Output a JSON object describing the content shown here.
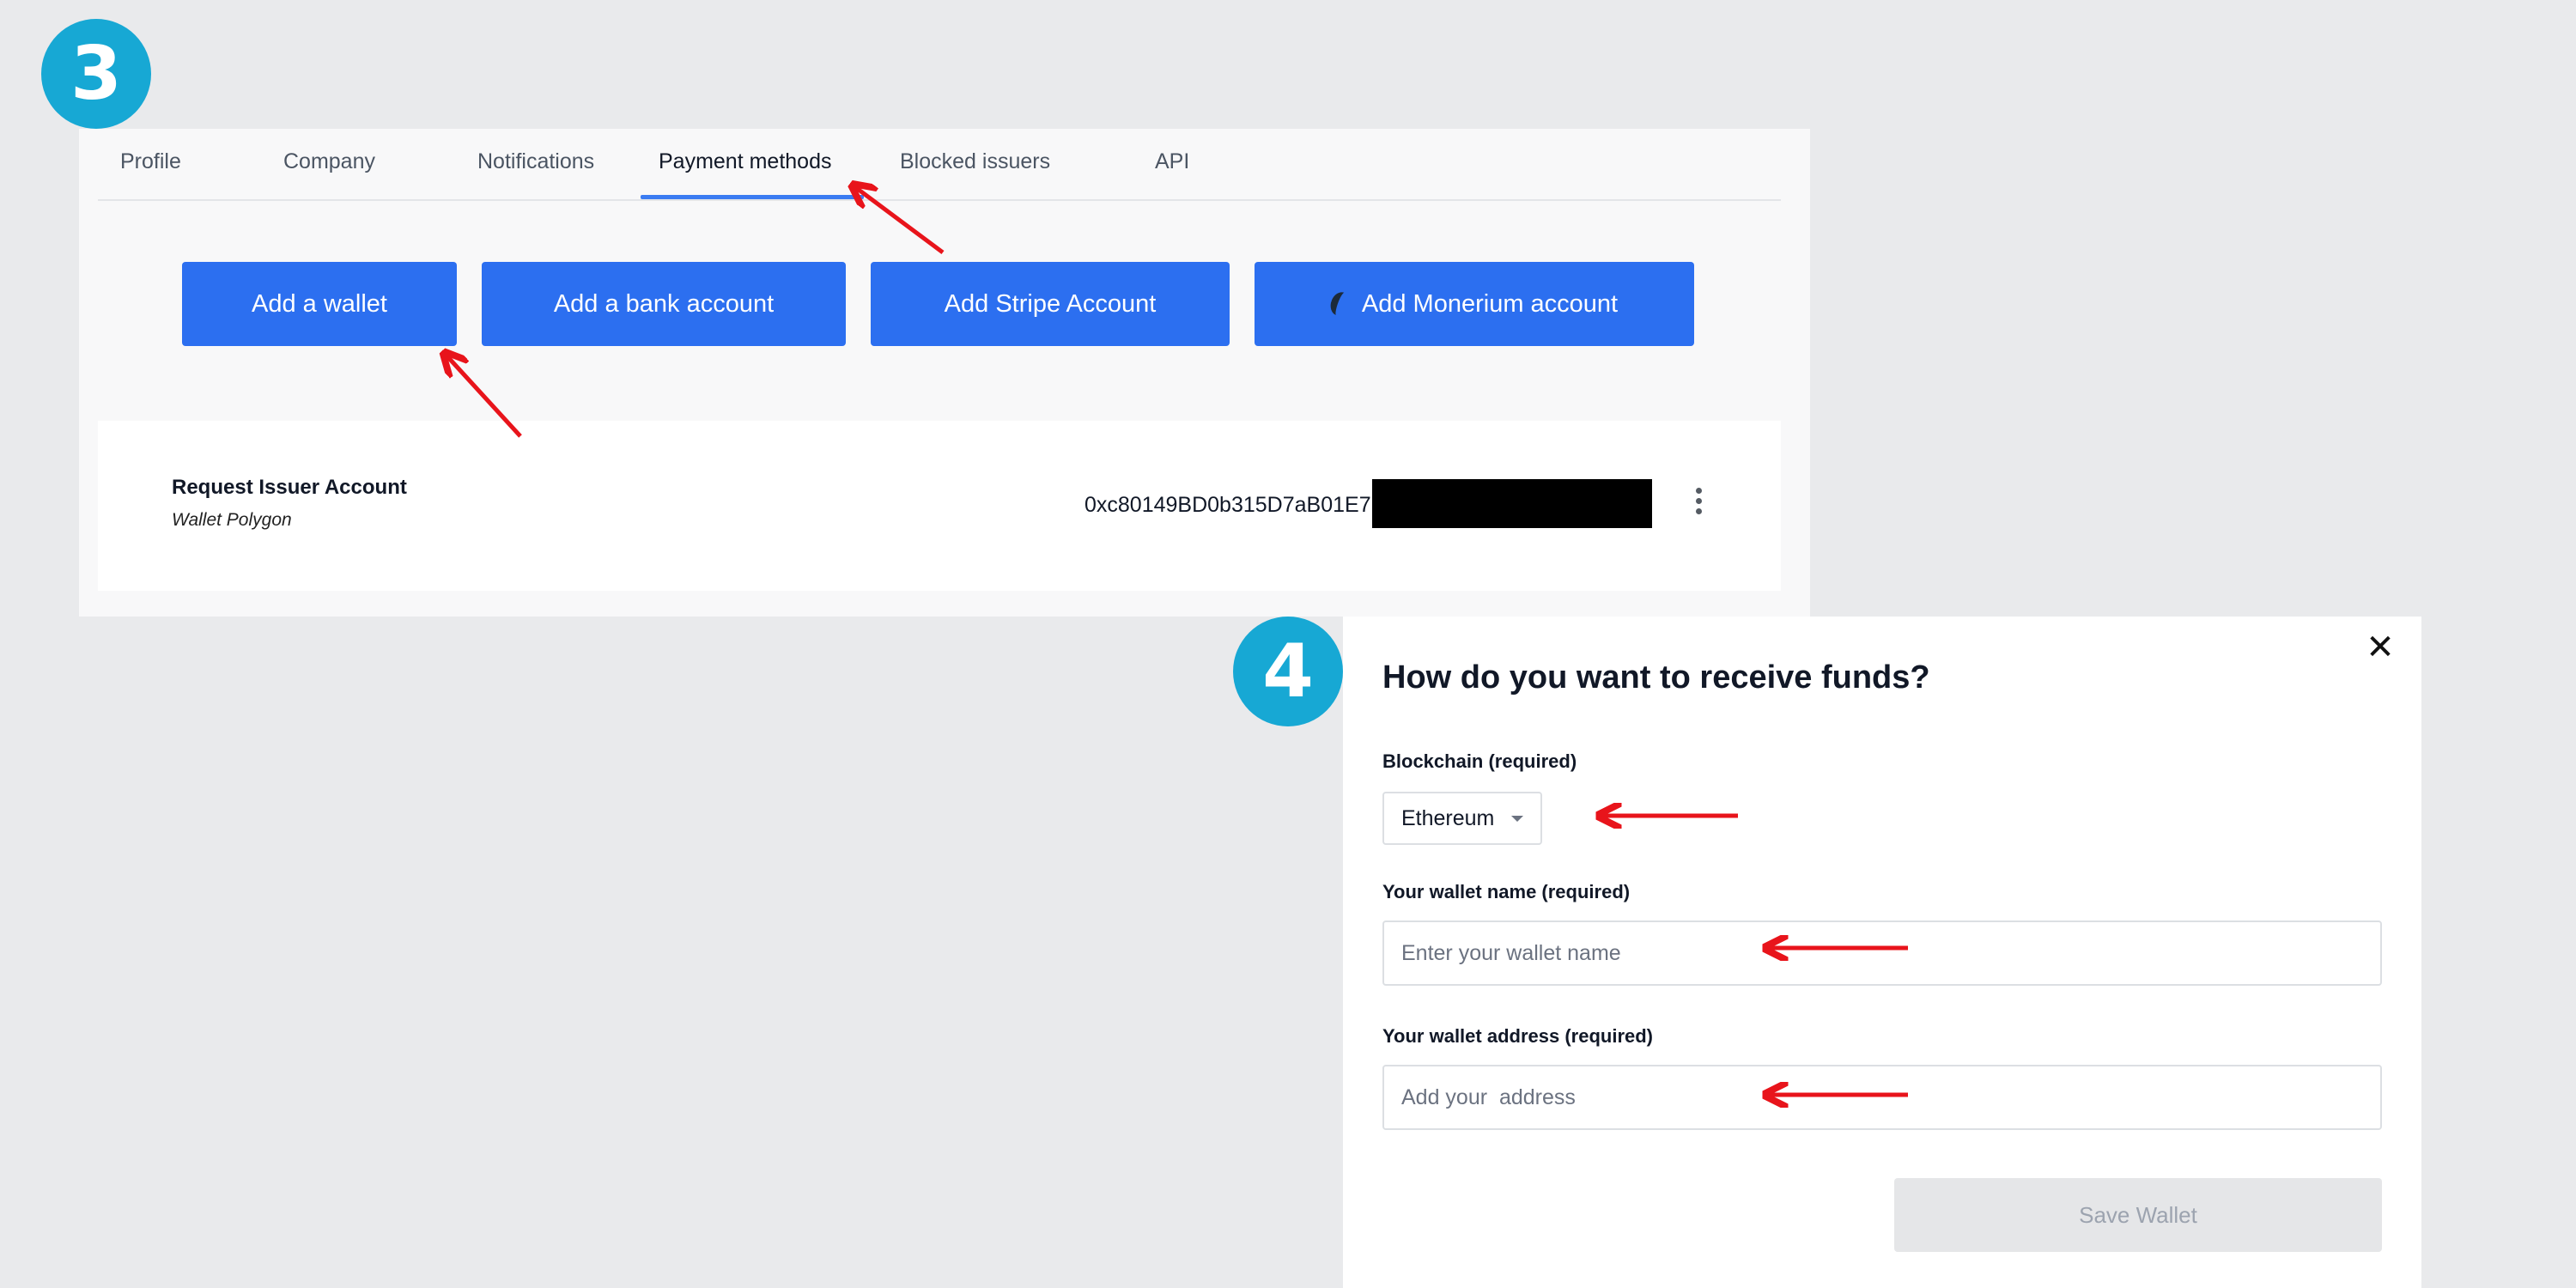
{
  "steps": {
    "first": "3",
    "second": "4"
  },
  "tabs": [
    {
      "label": "Profile"
    },
    {
      "label": "Company"
    },
    {
      "label": "Notifications"
    },
    {
      "label": "Payment methods"
    },
    {
      "label": "Blocked issuers"
    },
    {
      "label": "API"
    }
  ],
  "active_tab": "Payment methods",
  "actions": {
    "add_wallet": "Add a wallet",
    "add_bank": "Add a bank account",
    "add_stripe": "Add Stripe Account",
    "add_monerium": "Add Monerium account"
  },
  "account": {
    "name": "Request Issuer Account",
    "type": "Wallet Polygon",
    "address_visible": "0xc80149BD0b315D7aB01E7"
  },
  "modal": {
    "title": "How do you want to receive funds?",
    "blockchain_label": "Blockchain (required)",
    "blockchain_value": "Ethereum",
    "wallet_name_label": "Your wallet name (required)",
    "wallet_name_placeholder": "Enter your wallet name",
    "wallet_address_label": "Your wallet address (required)",
    "wallet_address_placeholder": "Add your  address",
    "save_label": "Save Wallet",
    "close_symbol": "✕"
  },
  "colors": {
    "badge": "#17a8d4",
    "primary_button": "#2c6ff0",
    "annotation_arrow": "#e8141b",
    "active_tab_underline": "#3b7cf2"
  },
  "icons": [
    "close-icon",
    "chevron-down-icon",
    "kebab-menu-icon",
    "monerium-logo-icon"
  ]
}
